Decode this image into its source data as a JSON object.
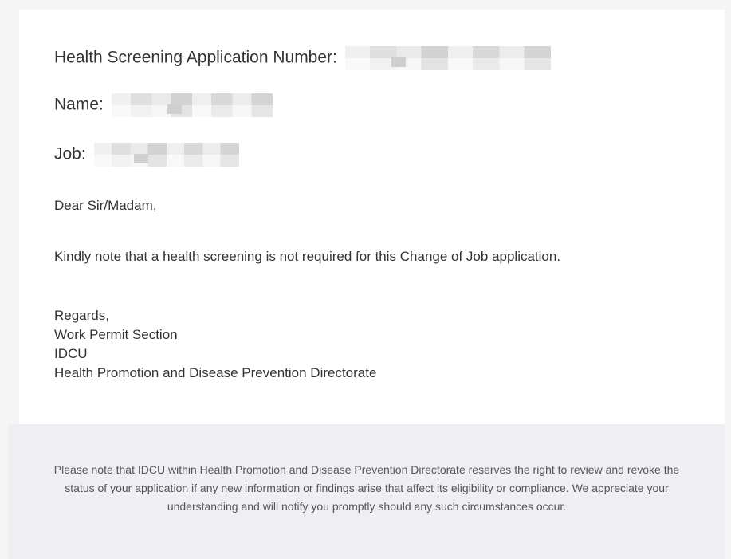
{
  "email": {
    "application_number_label": "Health Screening Application Number:",
    "name_label": "Name:",
    "job_label": "Job:",
    "greeting": "Dear Sir/Madam,",
    "message": "Kindly note that a health screening is not required for this Change of Job application.",
    "signature": {
      "closing": "Regards,",
      "section": "Work Permit Section",
      "unit": "IDCU",
      "directorate": "Health Promotion and Disease Prevention Directorate"
    }
  },
  "footer": {
    "disclaimer": "Please note that IDCU within Health Promotion and Disease Prevention Directorate reserves the right to review and revoke the status of your application if any new information or findings arise that affect its eligibility or compliance. We appreciate your understanding and will notify you promptly should any such circumstances occur."
  }
}
